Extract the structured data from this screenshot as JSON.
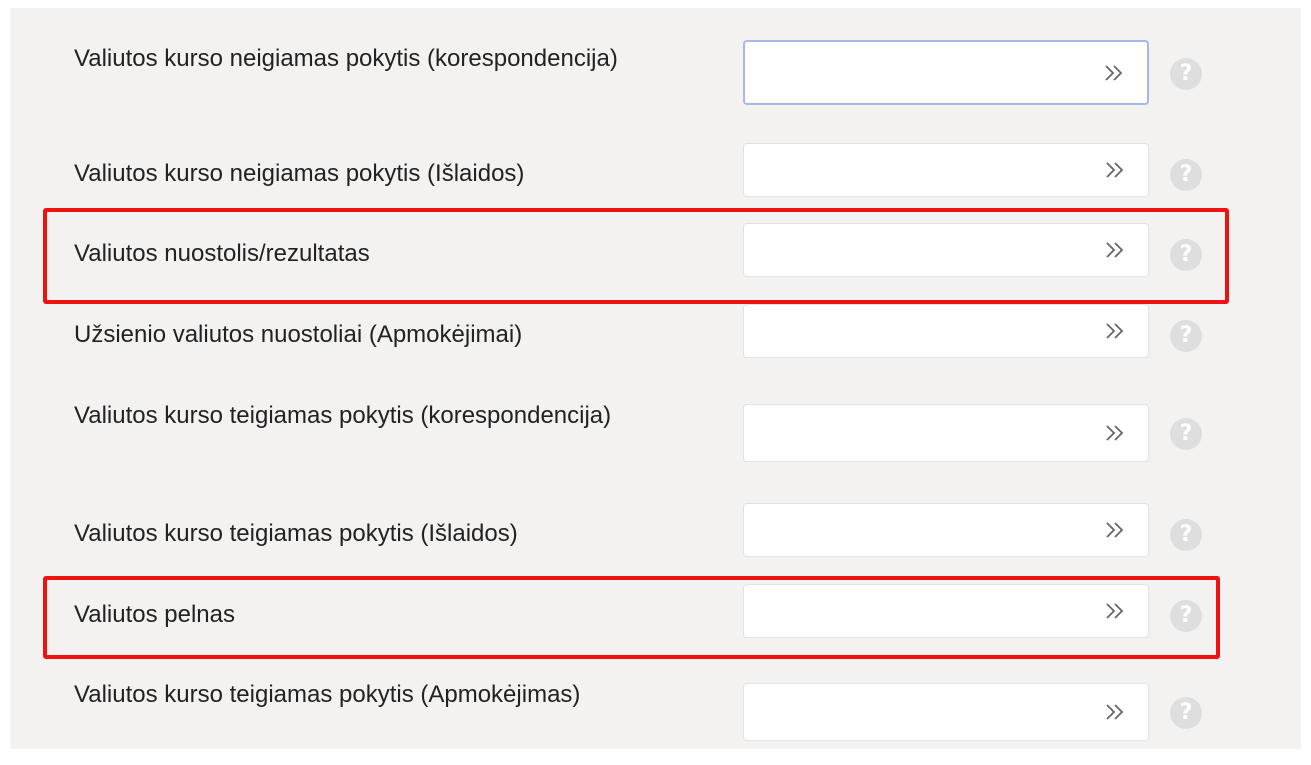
{
  "icons": {
    "field_button": "double-chevron-right-icon",
    "help": "question-mark-icon"
  },
  "colors": {
    "highlight": "#ee1111",
    "focus_border": "#a9b6ea",
    "help_icon": "#dedede"
  },
  "fields": [
    {
      "label": "Valiutos kurso neigiamas pokytis (korespondencija)",
      "value": "",
      "focused": true,
      "highlighted": false
    },
    {
      "label": "Valiutos kurso neigiamas pokytis (Išlaidos)",
      "value": "",
      "focused": false,
      "highlighted": false
    },
    {
      "label": "Valiutos nuostolis/rezultatas",
      "value": "",
      "focused": false,
      "highlighted": true
    },
    {
      "label": "Užsienio valiutos nuostoliai (Apmokėjimai)",
      "value": "",
      "focused": false,
      "highlighted": false
    },
    {
      "label": "Valiutos kurso teigiamas pokytis (korespondencija)",
      "value": "",
      "focused": false,
      "highlighted": false
    },
    {
      "label": "Valiutos kurso teigiamas pokytis (Išlaidos)",
      "value": "",
      "focused": false,
      "highlighted": false
    },
    {
      "label": "Valiutos pelnas",
      "value": "",
      "focused": false,
      "highlighted": true
    },
    {
      "label": "Valiutos kurso teigiamas pokytis (Apmokėjimas)",
      "value": "",
      "focused": false,
      "highlighted": false
    }
  ],
  "help_glyph": "?"
}
